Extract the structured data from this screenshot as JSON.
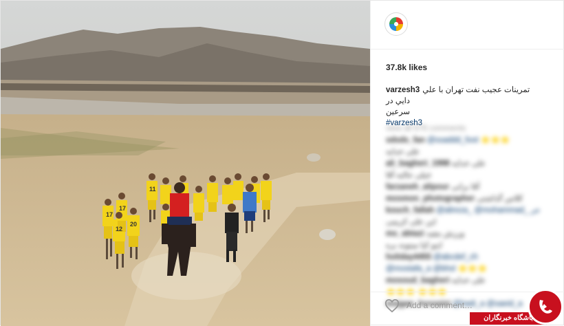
{
  "post": {
    "likes": "37.8k likes",
    "caption_user": "varzesh3",
    "caption_text": "تمرينات عجيب نفت تهران با علي دايي در",
    "caption_text_line2": "سرعين",
    "hashtag": "#varzesh3",
    "add_comment_placeholder": "Add a comment…"
  },
  "comments_blurred": {
    "view_all": "view all 676 comments",
    "rows": [
      {
        "user": "sdsds_fan",
        "text": "@ssaddd_foot ⭐⭐⭐"
      },
      {
        "user": "",
        "text": "علی خدایه"
      },
      {
        "user": "ali_bagheri_1998",
        "text": "علی خدایه"
      },
      {
        "user": "",
        "text": "خیلی جالبه آقا"
      },
      {
        "user": "farzaneh_alipour",
        "text": "آقا برانی"
      },
      {
        "user": "mosmon_photographer",
        "text": "کلاس گذاشتی"
      },
      {
        "user": "kouch_fallah",
        "text": "@alireza_ @mohammad_ جر"
      },
      {
        "user": "",
        "text": "این علی کریمی"
      },
      {
        "user": "ms_abtazi",
        "text": "ورزش مفید"
      },
      {
        "user": "",
        "text": "اینو کیا میتونه بره"
      },
      {
        "user": "holiday4455",
        "text": "@abcdef_ch"
      },
      {
        "user": "",
        "text": "@mostafa_a @bhsl ⭐⭐⭐"
      },
      {
        "user": "mosoud_bagheri",
        "text": "علی خدایه"
      },
      {
        "user": "",
        "text": "⭐⭐⭐ ⭐⭐⭐"
      },
      {
        "user": "mojgan_hosseini",
        "text": "@hadi_a @saeid_a"
      }
    ]
  },
  "watermark": {
    "label": "باشگاه خبرنگاران"
  },
  "photo_alt": {
    "players": [
      {
        "number": "17"
      },
      {
        "number": "17"
      },
      {
        "number": "12"
      },
      {
        "number": "20"
      },
      {
        "number": "11"
      }
    ]
  },
  "colors": {
    "jersey": "#f2d31b",
    "sky": "#c9cdcf",
    "ground": "#cdb590",
    "watermark_red": "#c8101e",
    "link": "#003569"
  },
  "icons": {
    "avatar": "varzesh3-logo-icon",
    "like": "heart-icon"
  }
}
